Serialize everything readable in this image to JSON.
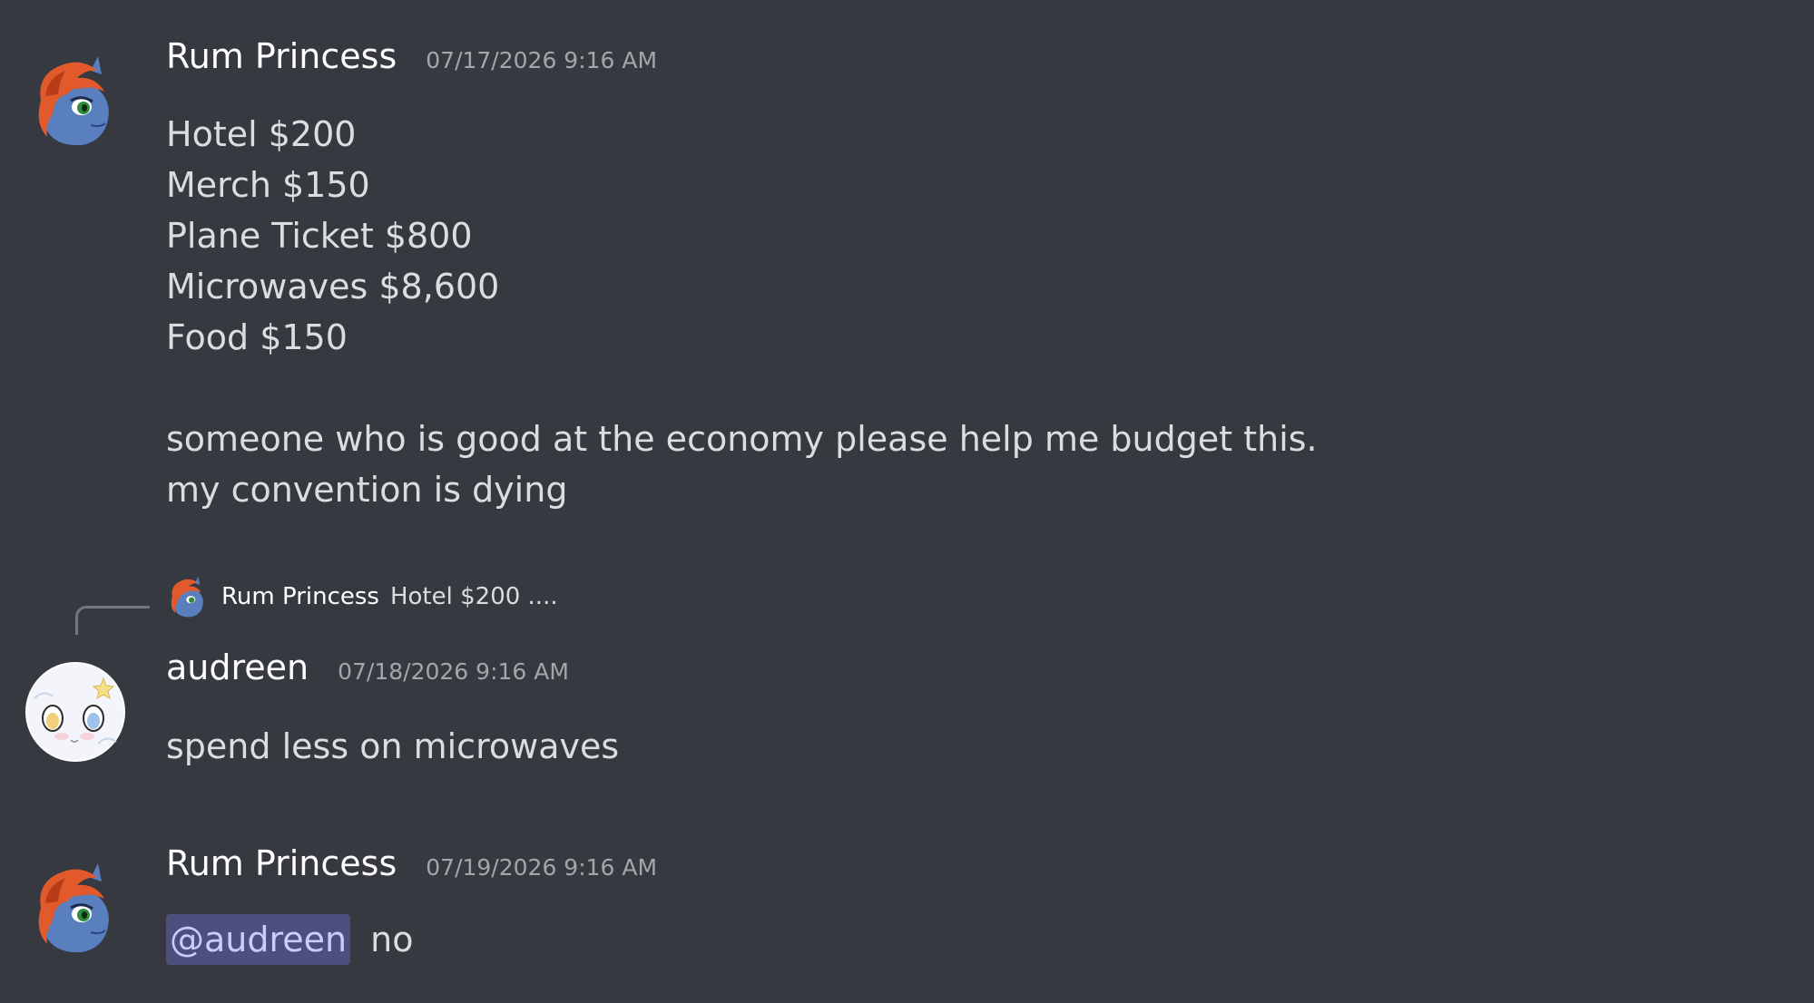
{
  "messages": [
    {
      "author": "Rum Princess",
      "timestamp": "07/17/2026 9:16 AM",
      "avatar": "rum-princess-avatar",
      "lines": [
        "Hotel $200",
        "Merch $150",
        "Plane Ticket $800",
        "Microwaves $8,600",
        "Food $150",
        "",
        "someone who is good at the economy please help me budget this.",
        "my convention is dying"
      ]
    },
    {
      "author": "audreen",
      "timestamp": "07/18/2026 9:16 AM",
      "avatar": "audreen-avatar",
      "reply_to": {
        "author": "Rum Princess",
        "preview": "Hotel $200 ...."
      },
      "lines": [
        "spend less on microwaves"
      ]
    },
    {
      "author": "Rum Princess",
      "timestamp": "07/19/2026 9:16 AM",
      "avatar": "rum-princess-avatar",
      "mention": "@audreen",
      "text_after_mention": "no"
    }
  ],
  "colors": {
    "background": "#36393f",
    "username": "#ffffff",
    "timestamp": "#a3a6aa",
    "text": "#dcddde",
    "mention_bg": "#4d507e",
    "mention_text": "#c9cdfb"
  }
}
